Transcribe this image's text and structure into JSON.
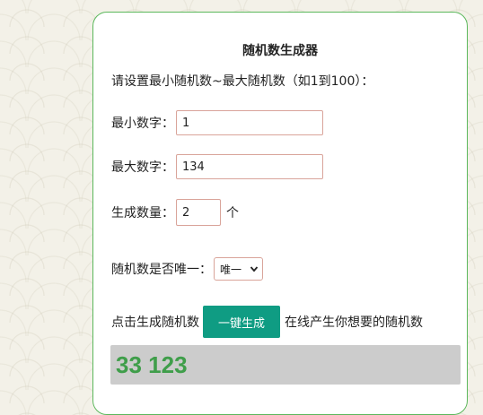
{
  "title": "随机数生成器",
  "intro": "请设置最小随机数~最大随机数（如1到100）：",
  "min_field": {
    "label": "最小数字：",
    "value": "1"
  },
  "max_field": {
    "label": "最大数字：",
    "value": "134"
  },
  "count_field": {
    "label": "生成数量：",
    "value": "2",
    "unit": "个"
  },
  "unique_field": {
    "label": "随机数是否唯一：",
    "selected": "唯一"
  },
  "generate": {
    "prefix": "点击生成随机数",
    "button_label": "一键生成",
    "suffix": "在线产生你想要的随机数"
  },
  "result": "33 123",
  "colors": {
    "accent": "#0f9c83",
    "result_text": "#3f9e4a",
    "card_border": "#5cb85c"
  }
}
